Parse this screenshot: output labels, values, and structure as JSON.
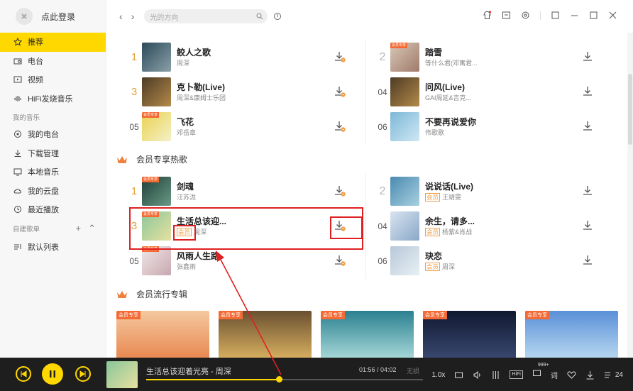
{
  "sidebar": {
    "login": "点此登录",
    "nav": [
      {
        "label": "推荐",
        "icon": "star-icon",
        "active": true
      },
      {
        "label": "电台",
        "icon": "radio-icon"
      },
      {
        "label": "视频",
        "icon": "video-icon"
      },
      {
        "label": "HiFi发烧音乐",
        "icon": "hifi-icon"
      }
    ],
    "my_music_title": "我的音乐",
    "my_music": [
      {
        "label": "我的电台",
        "icon": "my-radio-icon"
      },
      {
        "label": "下载管理",
        "icon": "download-icon"
      },
      {
        "label": "本地音乐",
        "icon": "monitor-icon"
      },
      {
        "label": "我的云盘",
        "icon": "cloud-icon"
      },
      {
        "label": "最近播放",
        "icon": "clock-icon"
      }
    ],
    "playlist_title": "自建歌单",
    "playlists": [
      {
        "label": "默认列表",
        "icon": "list-icon"
      }
    ]
  },
  "topbar": {
    "search_placeholder": "光的方向"
  },
  "top_songs": {
    "left": [
      {
        "rank": "1",
        "title": "鲛人之歌",
        "artist": "周深"
      },
      {
        "rank": "3",
        "title": "克卜勒(Live)",
        "artist": "周深&康姆士乐团"
      },
      {
        "rank": "05",
        "title": "飞花",
        "artist": "邓岳章"
      }
    ],
    "right": [
      {
        "rank": "2",
        "title": "踏雪",
        "artist": "等什么君(邓寓君..."
      },
      {
        "rank": "04",
        "title": "问风(Live)",
        "artist": "GAI周延&吉克..."
      },
      {
        "rank": "06",
        "title": "不要再说爱你",
        "artist": "伟歌歌"
      }
    ]
  },
  "vip_hot": {
    "title": "会员专享热歌",
    "left": [
      {
        "rank": "1",
        "title": "剑魂",
        "artist": "汪苏泷",
        "vip": false
      },
      {
        "rank": "3",
        "title": "生活总该迎...",
        "artist": "周深",
        "vip": true
      },
      {
        "rank": "05",
        "title": "风雨人生路",
        "artist": "张鑫雨",
        "vip": false
      }
    ],
    "right": [
      {
        "rank": "2",
        "title": "说说话(Live)",
        "artist": "王靖雯",
        "vip": true
      },
      {
        "rank": "04",
        "title": "余生，请多...",
        "artist": "杨紫&肖战",
        "vip": true
      },
      {
        "rank": "06",
        "title": "玦恋",
        "artist": "周深",
        "vip": true
      }
    ],
    "vip_label": "会员"
  },
  "vip_albums": {
    "title": "会员流行专辑",
    "tag": "会员专享"
  },
  "player": {
    "now_playing": "生活总该迎着光亮 - 周深",
    "time": "01:56 / 04:02",
    "lyrics": "无损",
    "progress": 0.48,
    "speed": "1.0x",
    "hifi": "HiFi",
    "comments": "999+",
    "lyric_btn": "词",
    "queue_count": "24"
  },
  "colors": {
    "accent": "#ffd800",
    "vip": "#f0a04b",
    "highlight": "#e02020"
  }
}
